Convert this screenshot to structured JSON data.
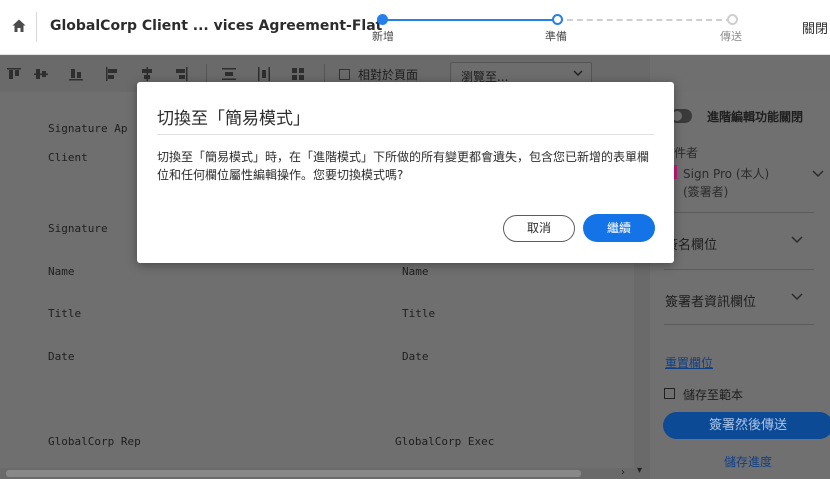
{
  "header": {
    "document_title": "GlobalCorp Client ... vices Agreement-Flat",
    "steps": [
      {
        "label": "新增"
      },
      {
        "label": "準備"
      },
      {
        "label": "傳送"
      }
    ],
    "close_label": "關閉"
  },
  "toolbar": {
    "relative_page_label": "相對於頁面",
    "browse_select_value": "瀏覽至..."
  },
  "document": {
    "lines": [
      "Signature Ap",
      "Client",
      "Signature",
      "Name",
      "Name",
      "Title",
      "Title",
      "Date",
      "Date",
      "GlobalCorp Rep",
      "GlobalCorp Exec"
    ]
  },
  "right_panel": {
    "toggle_label": "進階編輯功能關閉",
    "document_owner_label": "件者",
    "signer_name": "Sign Pro (本人)",
    "signer_role": "(簽署者)",
    "signature_fields_label": "簽名欄位",
    "signer_info_fields_label": "簽署者資訊欄位",
    "reset_fields_link": "重置欄位",
    "save_template_label": "儲存至範本",
    "sign_and_send_label": "簽署然後傳送",
    "save_progress_label": "儲存進度"
  },
  "modal": {
    "title": "切換至「簡易模式」",
    "body": "切換至「簡易模式」時，在「進階模式」下所做的所有變更都會遺失，包含您已新增的表單欄位和任何欄位屬性編輯操作。您要切換模式嗎?",
    "cancel_label": "取消",
    "continue_label": "繼續"
  },
  "colors": {
    "accent": "#1473e6",
    "step_active": "#2680eb",
    "overlay": "#6f6f6f"
  }
}
